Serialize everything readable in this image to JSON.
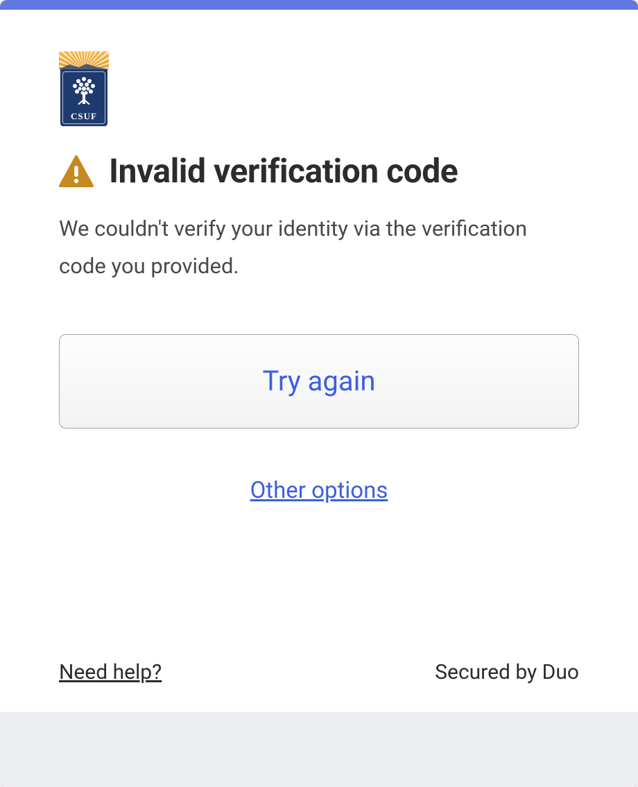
{
  "logo": {
    "label": "CSUF"
  },
  "heading": "Invalid verification code",
  "message": "We couldn't verify your identity via the verification code you provided.",
  "primary_button": "Try again",
  "other_options": "Other options",
  "footer": {
    "need_help": "Need help?",
    "secured_by": "Secured by Duo"
  },
  "colors": {
    "accent_bar": "#6079e0",
    "link": "#3b5fe0",
    "warning": "#c6891f"
  }
}
